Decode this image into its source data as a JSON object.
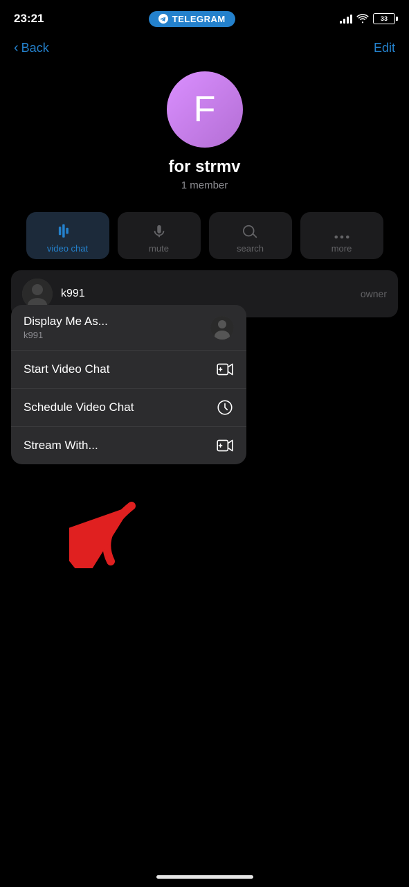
{
  "statusBar": {
    "time": "23:21",
    "battery": "33",
    "telegramLabel": "TELEGRAM"
  },
  "nav": {
    "backLabel": "Back",
    "editLabel": "Edit"
  },
  "profile": {
    "avatarLetter": "F",
    "name": "for strmv",
    "members": "1 member"
  },
  "actionButtons": [
    {
      "id": "video-chat",
      "label": "video chat",
      "active": true
    },
    {
      "id": "mute",
      "label": "mute",
      "active": false
    },
    {
      "id": "search",
      "label": "search",
      "active": false
    },
    {
      "id": "more",
      "label": "more",
      "active": false
    }
  ],
  "dropdown": {
    "items": [
      {
        "id": "display-me-as",
        "title": "Display Me As...",
        "subtitle": "k991",
        "iconType": "avatar"
      },
      {
        "id": "start-video-chat",
        "title": "Start Video Chat",
        "subtitle": "",
        "iconType": "video"
      },
      {
        "id": "schedule-video-chat",
        "title": "Schedule Video Chat",
        "subtitle": "",
        "iconType": "clock"
      },
      {
        "id": "stream-with",
        "title": "Stream With...",
        "subtitle": "",
        "iconType": "stream"
      }
    ]
  },
  "membersList": {
    "items": [
      {
        "name": "k991",
        "role": "owner"
      }
    ]
  }
}
